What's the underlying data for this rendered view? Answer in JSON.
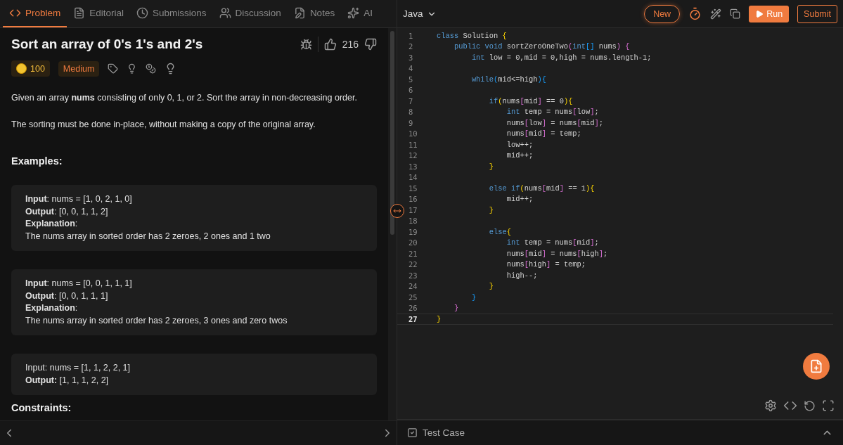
{
  "left_tabs": [
    {
      "label": "Problem",
      "selected": true
    },
    {
      "label": "Editorial",
      "selected": false
    },
    {
      "label": "Submissions",
      "selected": false
    },
    {
      "label": "Discussion",
      "selected": false
    },
    {
      "label": "Notes",
      "selected": false
    },
    {
      "label": "AI",
      "selected": false
    }
  ],
  "problem": {
    "title": "Sort an array of 0's 1's and 2's",
    "likes": "216",
    "coins": "100",
    "difficulty": "Medium",
    "description": [
      "Given an array **nums** consisting of only 0, 1, or 2. Sort the array in non-decreasing order.",
      "The sorting must be done in-place, without making a copy of the original array."
    ],
    "examples_heading": "Examples:",
    "examples": [
      {
        "lines": [
          "**Input**: nums = [1, 0, 2, 1, 0]",
          "**Output**: [0, 0, 1, 1, 2]",
          "**Explanation**:",
          "The nums array in sorted order has 2 zeroes, 2 ones and 1 two"
        ]
      },
      {
        "lines": [
          "**Input**: nums = [0, 0, 1, 1, 1]",
          "**Output**: [0, 0, 1, 1, 1]",
          "**Explanation**:",
          "The nums array in sorted order has 2 zeroes, 3 ones and zero twos"
        ]
      },
      {
        "lines": [
          "Input: nums = [1, 1, 2, 2, 1]",
          "**Output:** [1, 1, 1, 2, 2]"
        ]
      }
    ],
    "constraints_heading": "Constraints:"
  },
  "editor": {
    "language": "Java",
    "new_badge": "New",
    "run_button": "Run",
    "submit_button": "Submit",
    "lines": [
      {
        "number": "1",
        "current": false,
        "tokens": [
          {
            "kind": "kw",
            "text": "class"
          },
          {
            "kind": "id",
            "text": " Solution "
          },
          {
            "kind": "b1",
            "text": "{"
          }
        ]
      },
      {
        "number": "2",
        "current": false,
        "tokens": [
          {
            "kind": "kw",
            "text": "    public void"
          },
          {
            "kind": "id",
            "text": " sortZeroOneTwo"
          },
          {
            "kind": "b2",
            "text": "("
          },
          {
            "kind": "kw",
            "text": "int"
          },
          {
            "kind": "b3",
            "text": "[]"
          },
          {
            "kind": "id",
            "text": " nums"
          },
          {
            "kind": "b2",
            "text": ") {"
          }
        ]
      },
      {
        "number": "3",
        "current": false,
        "tokens": [
          {
            "kind": "kw",
            "text": "        int"
          },
          {
            "kind": "id",
            "text": " low = 0,mid = 0,high = nums.length-1;"
          }
        ]
      },
      {
        "number": "4",
        "current": false
      },
      {
        "number": "5",
        "current": false,
        "tokens": [
          {
            "kind": "kw",
            "text": "        while"
          },
          {
            "kind": "b3",
            "text": "("
          },
          {
            "kind": "id",
            "text": "mid<=high"
          },
          {
            "kind": "b3",
            "text": "){"
          }
        ]
      },
      {
        "number": "6",
        "current": false
      },
      {
        "number": "7",
        "current": false,
        "tokens": [
          {
            "kind": "kw",
            "text": "            if"
          },
          {
            "kind": "b1",
            "text": "("
          },
          {
            "kind": "id",
            "text": "nums"
          },
          {
            "kind": "b2",
            "text": "["
          },
          {
            "kind": "id",
            "text": "mid"
          },
          {
            "kind": "b2",
            "text": "]"
          },
          {
            "kind": "id",
            "text": " == 0"
          },
          {
            "kind": "b1",
            "text": "){"
          }
        ]
      },
      {
        "number": "8",
        "current": false,
        "tokens": [
          {
            "kind": "kw",
            "text": "                int"
          },
          {
            "kind": "id",
            "text": " temp = nums"
          },
          {
            "kind": "b2",
            "text": "["
          },
          {
            "kind": "id",
            "text": "low"
          },
          {
            "kind": "b2",
            "text": "]"
          },
          {
            "kind": "id",
            "text": ";"
          }
        ]
      },
      {
        "number": "9",
        "current": false,
        "tokens": [
          {
            "kind": "id",
            "text": "                nums"
          },
          {
            "kind": "b2",
            "text": "["
          },
          {
            "kind": "id",
            "text": "low"
          },
          {
            "kind": "b2",
            "text": "]"
          },
          {
            "kind": "id",
            "text": " = nums"
          },
          {
            "kind": "b2",
            "text": "["
          },
          {
            "kind": "id",
            "text": "mid"
          },
          {
            "kind": "b2",
            "text": "]"
          },
          {
            "kind": "id",
            "text": ";"
          }
        ]
      },
      {
        "number": "10",
        "current": false,
        "tokens": [
          {
            "kind": "id",
            "text": "                nums"
          },
          {
            "kind": "b2",
            "text": "["
          },
          {
            "kind": "id",
            "text": "mid"
          },
          {
            "kind": "b2",
            "text": "]"
          },
          {
            "kind": "id",
            "text": " = temp;"
          }
        ]
      },
      {
        "number": "11",
        "current": false,
        "tokens": [
          {
            "kind": "id",
            "text": "                low++;"
          }
        ]
      },
      {
        "number": "12",
        "current": false,
        "tokens": [
          {
            "kind": "id",
            "text": "                mid++;"
          }
        ]
      },
      {
        "number": "13",
        "current": false,
        "tokens": [
          {
            "kind": "b1",
            "text": "            }"
          }
        ]
      },
      {
        "number": "14",
        "current": false
      },
      {
        "number": "15",
        "current": false,
        "tokens": [
          {
            "kind": "kw",
            "text": "            else if"
          },
          {
            "kind": "b1",
            "text": "("
          },
          {
            "kind": "id",
            "text": "nums"
          },
          {
            "kind": "b2",
            "text": "["
          },
          {
            "kind": "id",
            "text": "mid"
          },
          {
            "kind": "b2",
            "text": "]"
          },
          {
            "kind": "id",
            "text": " == 1"
          },
          {
            "kind": "b1",
            "text": "){"
          }
        ]
      },
      {
        "number": "16",
        "current": false,
        "tokens": [
          {
            "kind": "id",
            "text": "                mid++;"
          }
        ]
      },
      {
        "number": "17",
        "current": false,
        "tokens": [
          {
            "kind": "b1",
            "text": "            }"
          }
        ]
      },
      {
        "number": "18",
        "current": false
      },
      {
        "number": "19",
        "current": false,
        "tokens": [
          {
            "kind": "kw",
            "text": "            else"
          },
          {
            "kind": "b1",
            "text": "{"
          }
        ]
      },
      {
        "number": "20",
        "current": false,
        "tokens": [
          {
            "kind": "kw",
            "text": "                int"
          },
          {
            "kind": "id",
            "text": " temp = nums"
          },
          {
            "kind": "b2",
            "text": "["
          },
          {
            "kind": "id",
            "text": "mid"
          },
          {
            "kind": "b2",
            "text": "]"
          },
          {
            "kind": "id",
            "text": ";"
          }
        ]
      },
      {
        "number": "21",
        "current": false,
        "tokens": [
          {
            "kind": "id",
            "text": "                nums"
          },
          {
            "kind": "b2",
            "text": "["
          },
          {
            "kind": "id",
            "text": "mid"
          },
          {
            "kind": "b2",
            "text": "]"
          },
          {
            "kind": "id",
            "text": " = nums"
          },
          {
            "kind": "b2",
            "text": "["
          },
          {
            "kind": "id",
            "text": "high"
          },
          {
            "kind": "b2",
            "text": "]"
          },
          {
            "kind": "id",
            "text": ";"
          }
        ]
      },
      {
        "number": "22",
        "current": false,
        "tokens": [
          {
            "kind": "id",
            "text": "                nums"
          },
          {
            "kind": "b2",
            "text": "["
          },
          {
            "kind": "id",
            "text": "high"
          },
          {
            "kind": "b2",
            "text": "]"
          },
          {
            "kind": "id",
            "text": " = temp;"
          }
        ]
      },
      {
        "number": "23",
        "current": false,
        "tokens": [
          {
            "kind": "id",
            "text": "                high--;"
          }
        ]
      },
      {
        "number": "24",
        "current": false,
        "tokens": [
          {
            "kind": "b1",
            "text": "            }"
          }
        ]
      },
      {
        "number": "25",
        "current": false,
        "tokens": [
          {
            "kind": "b3",
            "text": "        }"
          }
        ]
      },
      {
        "number": "26",
        "current": false,
        "tokens": [
          {
            "kind": "b2",
            "text": "    }"
          }
        ]
      },
      {
        "number": "27",
        "current": true,
        "tokens": [
          {
            "kind": "b1",
            "text": "}"
          }
        ]
      }
    ]
  },
  "test_case": {
    "label": "Test Case"
  }
}
